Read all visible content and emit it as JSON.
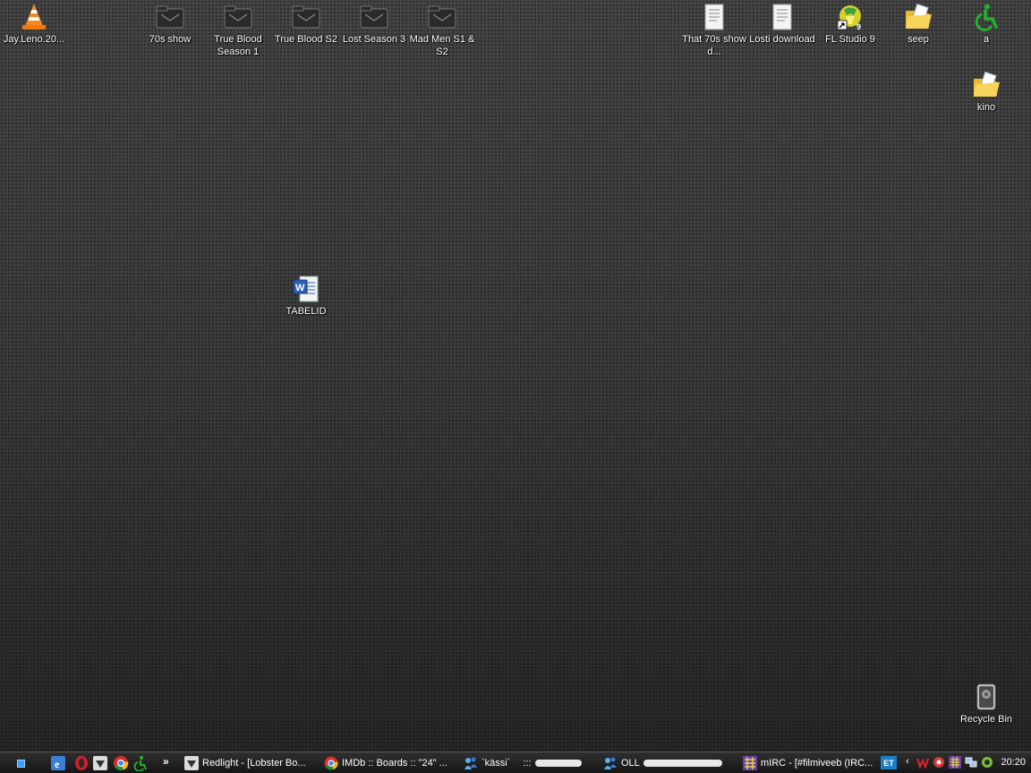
{
  "desktop": {
    "icons": [
      {
        "id": "jay-leno",
        "label": "Jay.Leno.20...",
        "icon": "vlc-cone-icon"
      },
      {
        "id": "70s-show",
        "label": "70s show",
        "icon": "folder-icon"
      },
      {
        "id": "true-blood-s1",
        "label": "True Blood Season 1",
        "icon": "folder-icon"
      },
      {
        "id": "true-blood-s2",
        "label": "True Blood S2",
        "icon": "folder-icon"
      },
      {
        "id": "lost-s3",
        "label": "Lost Season 3",
        "icon": "folder-icon"
      },
      {
        "id": "mad-men",
        "label": "Mad Men S1 & S2",
        "icon": "folder-icon"
      },
      {
        "id": "that-70s-show-d",
        "label": "That 70s show d...",
        "icon": "text-document-icon"
      },
      {
        "id": "losti-download",
        "label": "Losti download",
        "icon": "text-document-icon"
      },
      {
        "id": "fl-studio",
        "label": "FL Studio 9",
        "icon": "fl-studio-icon"
      },
      {
        "id": "seep",
        "label": "seep",
        "icon": "open-folder-icon"
      },
      {
        "id": "a",
        "label": "a",
        "icon": "accessibility-icon"
      },
      {
        "id": "kino",
        "label": "kino",
        "icon": "open-folder-icon"
      },
      {
        "id": "tabelid",
        "label": "TABELID",
        "icon": "word-document-icon"
      },
      {
        "id": "recycle-bin",
        "label": "Recycle Bin",
        "icon": "recycle-bin-icon"
      }
    ]
  },
  "taskbar": {
    "tasks": [
      {
        "label": "Redlight - [Lobster Bo...",
        "icon": "skull-icon"
      },
      {
        "label": "IMDb :: Boards :: \"24\" ...",
        "icon": "chrome-icon"
      },
      {
        "label": "`kässi`",
        "icon": "messenger-icon"
      },
      {
        "label": "OLL",
        "icon": "messenger-icon"
      },
      {
        "label": "mIRC - [#filmiveeb (IRC...",
        "icon": "mirc-icon"
      }
    ],
    "overflow_label": "»",
    "tray": {
      "language": "ET",
      "clock": "20:20"
    }
  }
}
